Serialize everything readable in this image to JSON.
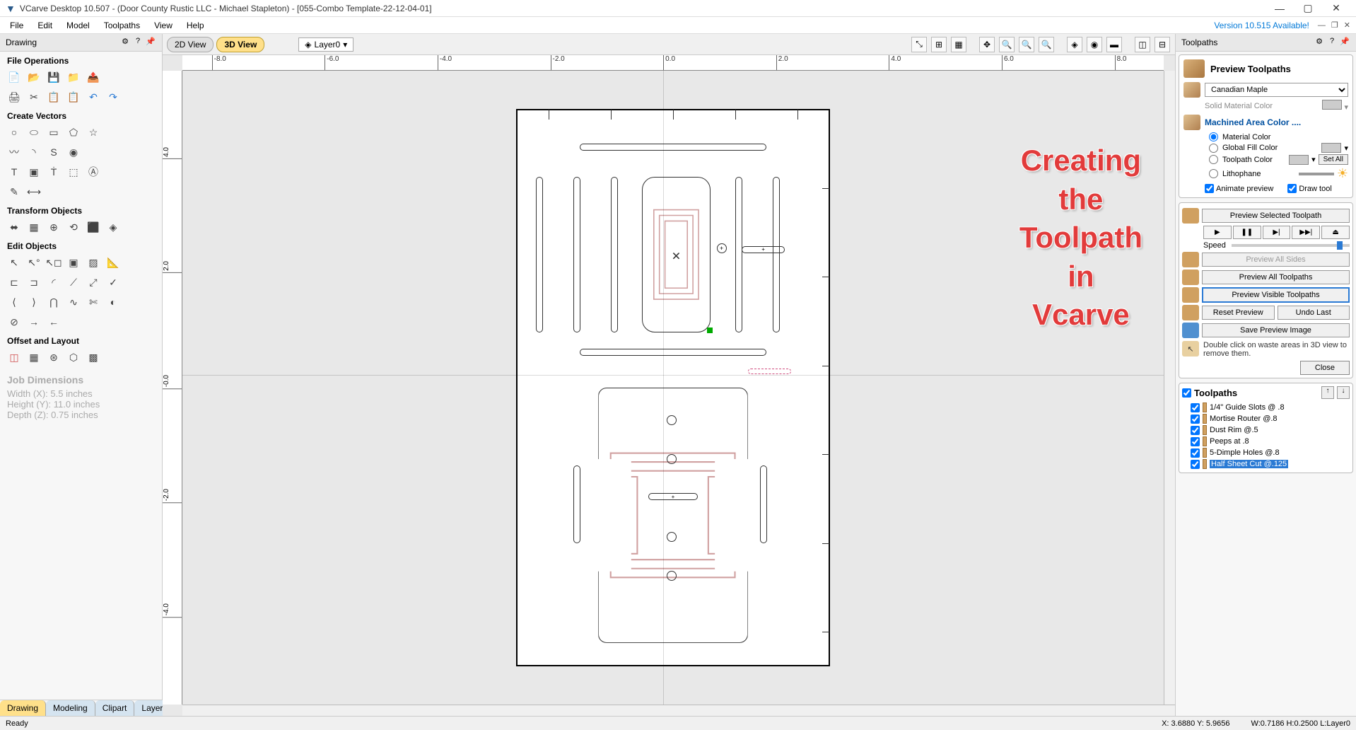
{
  "app": {
    "title": "VCarve Desktop 10.507 - (Door County Rustic LLC - Michael Stapleton) - [055-Combo Template-22-12-04-01]",
    "version_notice": "Version 10.515 Available!"
  },
  "menu": [
    "File",
    "Edit",
    "Model",
    "Toolpaths",
    "View",
    "Help"
  ],
  "left": {
    "panel_title": "Drawing",
    "sections": {
      "file_ops": "File Operations",
      "create_vectors": "Create Vectors",
      "transform": "Transform Objects",
      "edit": "Edit Objects",
      "offset": "Offset and Layout"
    },
    "job": {
      "heading": "Job Dimensions",
      "width": "Width  (X): 5.5 inches",
      "height": "Height (Y): 11.0 inches",
      "depth": "Depth  (Z): 0.75 inches"
    },
    "tabs": [
      "Drawing",
      "Modeling",
      "Clipart",
      "Layers"
    ]
  },
  "center": {
    "view_tabs": {
      "v2d": "2D View",
      "v3d": "3D View"
    },
    "layer": "Layer0",
    "ruler_x": [
      "-8.0",
      "-6.0",
      "-4.0",
      "-2.0",
      "0.0",
      "2.0",
      "4.0",
      "6.0",
      "8.0"
    ],
    "ruler_y": [
      "-4.0",
      "-2.0",
      "-0.0",
      "2.0",
      "4.0"
    ],
    "overlay": "Creating\nthe\nToolpath\nin\nVcarve"
  },
  "right": {
    "panel_title": "Toolpaths",
    "preview_title": "Preview Toolpaths",
    "material": "Canadian Maple",
    "solid_mat_color": "Solid Material Color",
    "machined_area": "Machined Area Color ....",
    "radios": {
      "material": "Material Color",
      "global": "Global Fill Color",
      "toolpath": "Toolpath Color",
      "litho": "Lithophane"
    },
    "set_all": "Set All",
    "animate": "Animate preview",
    "draw_tool": "Draw tool",
    "preview_selected": "Preview Selected Toolpath",
    "speed": "Speed",
    "preview_all_sides": "Preview All Sides",
    "preview_all": "Preview All Toolpaths",
    "preview_visible": "Preview Visible Toolpaths",
    "reset": "Reset Preview",
    "undo": "Undo Last",
    "save_img": "Save Preview Image",
    "hint": "Double click on waste areas in 3D view to remove them.",
    "close": "Close",
    "list_title": "Toolpaths",
    "toolpaths": [
      "1/4\" Guide Slots @ .8",
      "Mortise Router @.8",
      "Dust Rim @.5",
      "Peeps at .8",
      "5-Dimple Holes @.8",
      "Half Sheet Cut @.125"
    ]
  },
  "status": {
    "ready": "Ready",
    "xy": "X: 3.6880 Y: 5.9656",
    "whl": "W:0.7186  H:0.2500  L:Layer0"
  }
}
